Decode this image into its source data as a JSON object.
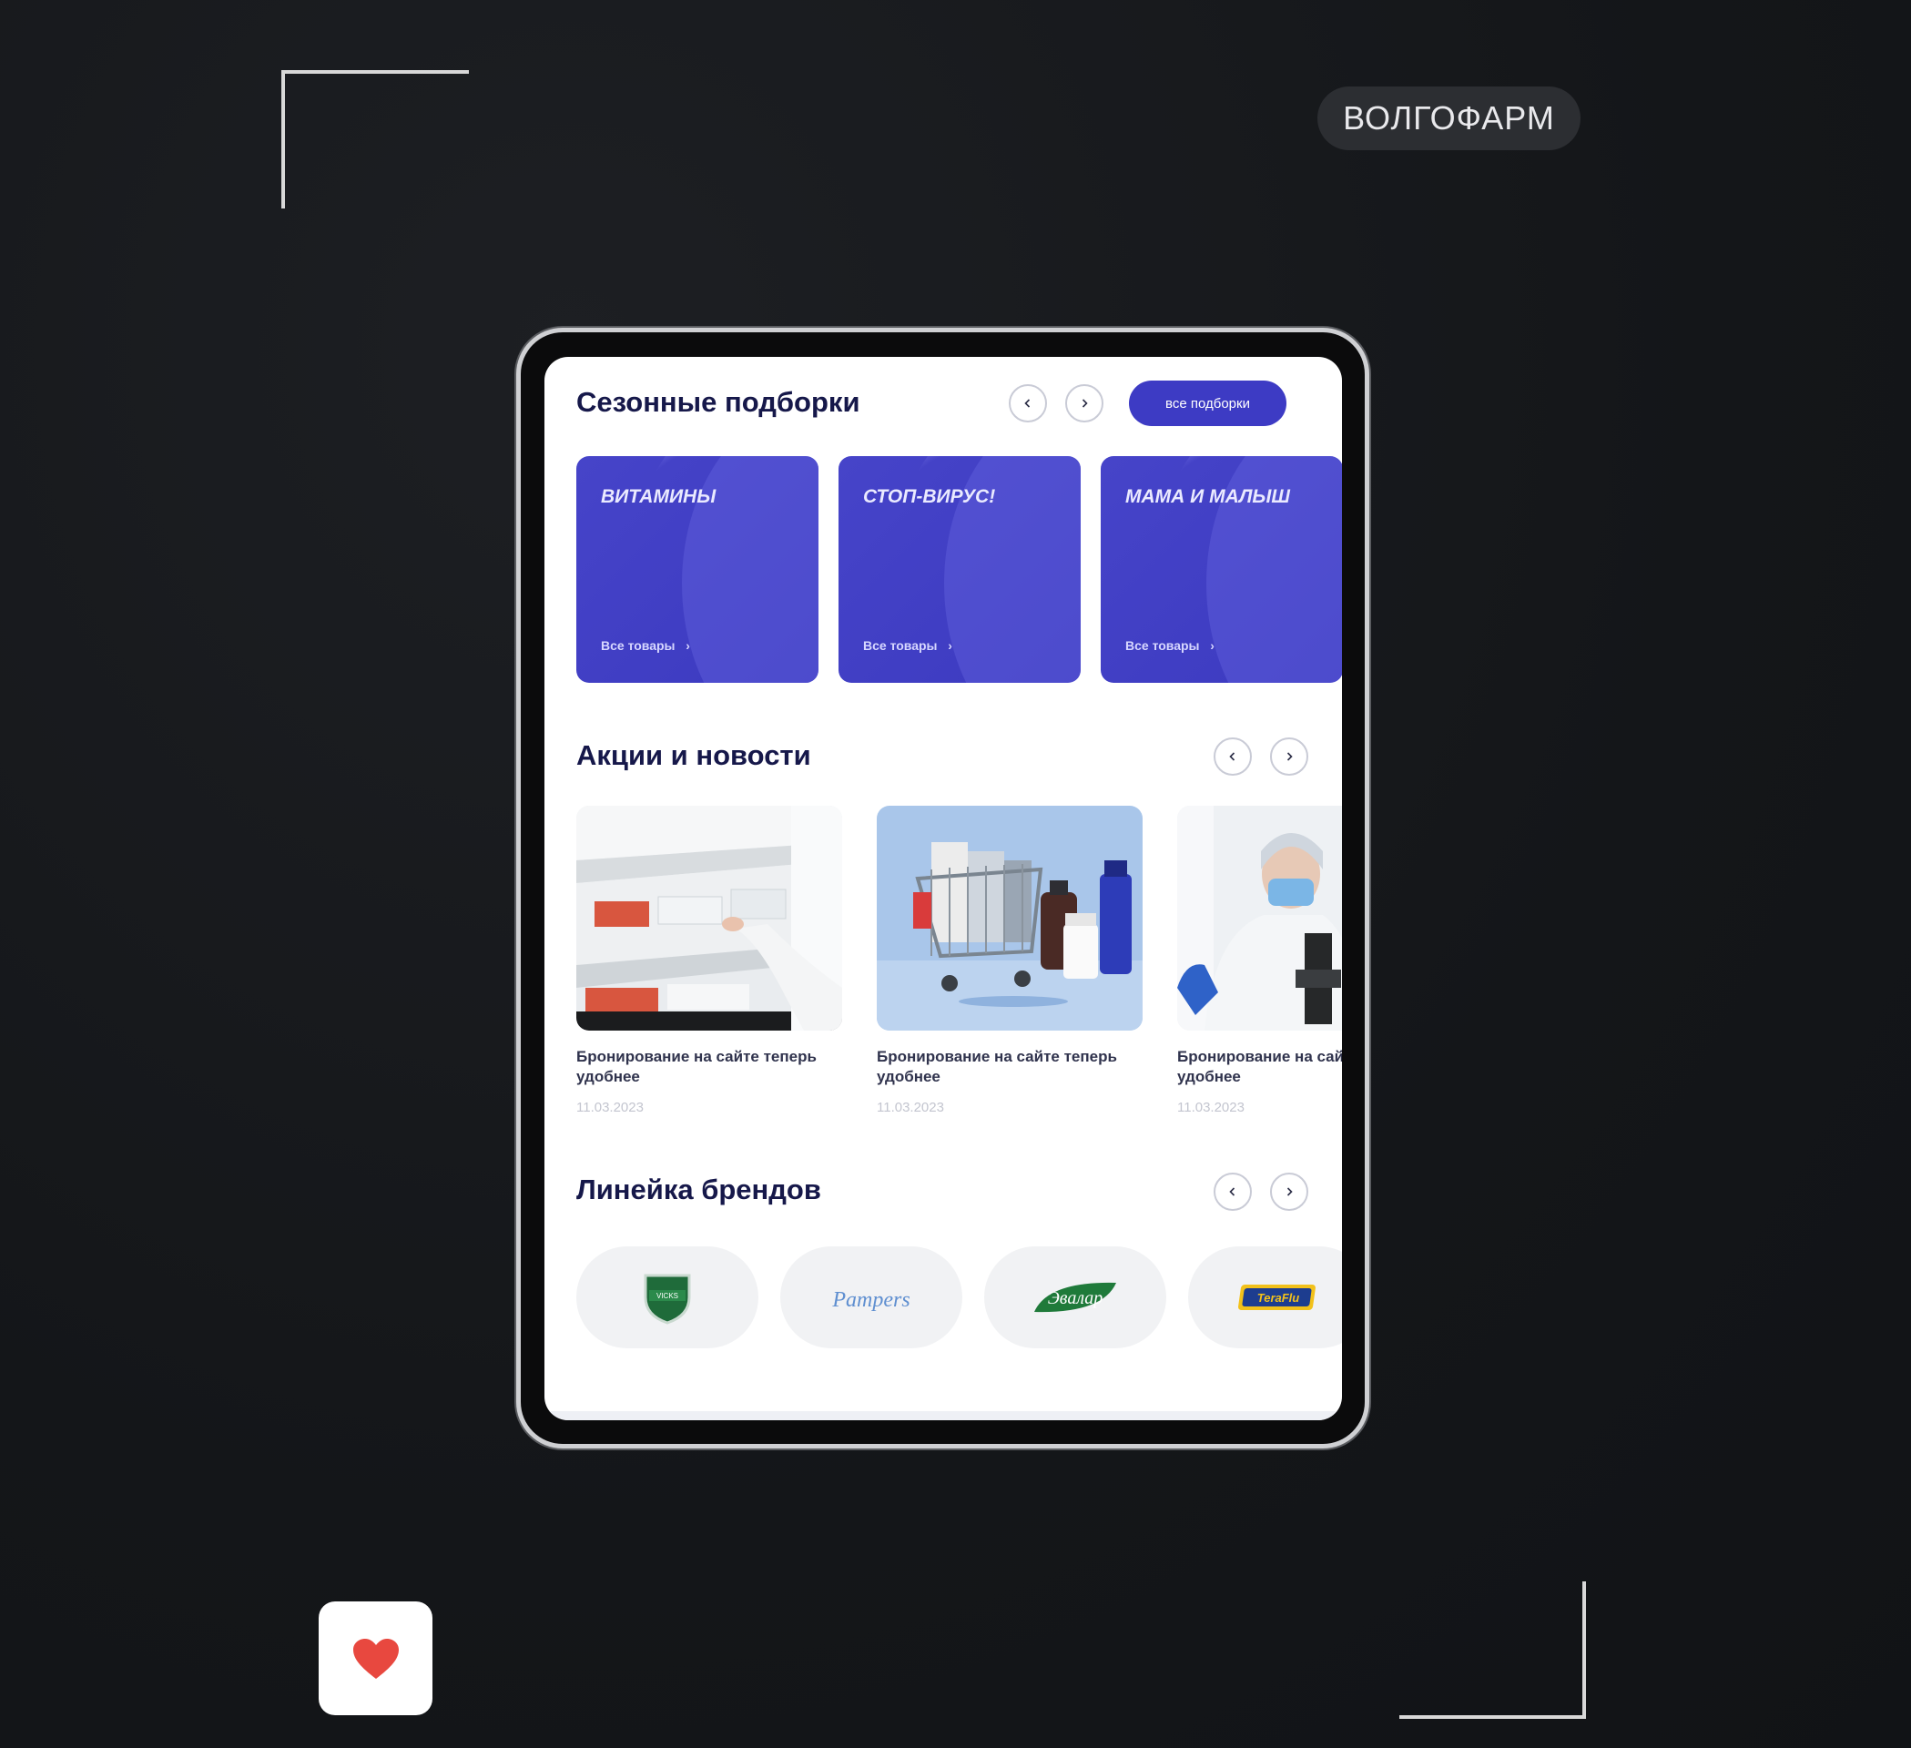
{
  "header": {
    "brand": "ВОЛГОФАРМ"
  },
  "seasonal": {
    "title": "Сезонные подборки",
    "all_button": "все подборки",
    "cards": [
      {
        "title": "ВИТАМИНЫ",
        "link": "Все товары"
      },
      {
        "title": "СТОП-ВИРУС!",
        "link": "Все товары"
      },
      {
        "title": "МАМА И МАЛЫШ",
        "link": "Все товары"
      }
    ]
  },
  "news": {
    "title": "Акции  и новости",
    "items": [
      {
        "text": "Бронирование на сайте теперь удобнее",
        "date": "11.03.2023"
      },
      {
        "text": "Бронирование на сайте теперь удобнее",
        "date": "11.03.2023"
      },
      {
        "text": "Бронирование на сайте теперь удобнее",
        "date": "11.03.2023"
      }
    ]
  },
  "brands": {
    "title": "Линейка брендов",
    "items": [
      {
        "name": "VICKS",
        "color": "#1f6b3a"
      },
      {
        "name": "Pampers",
        "color": "#5f8fd0"
      },
      {
        "name": "Эвалар",
        "color": "#1f7a3a"
      },
      {
        "name": "TeraFlu",
        "color": "#1d3d8f"
      }
    ]
  },
  "colors": {
    "accent": "#3d3bc4",
    "heart": "#e8483f",
    "heading": "#16184a"
  },
  "icons": {
    "prev": "chevron-left-icon",
    "next": "chevron-right-icon",
    "like": "heart-icon"
  }
}
